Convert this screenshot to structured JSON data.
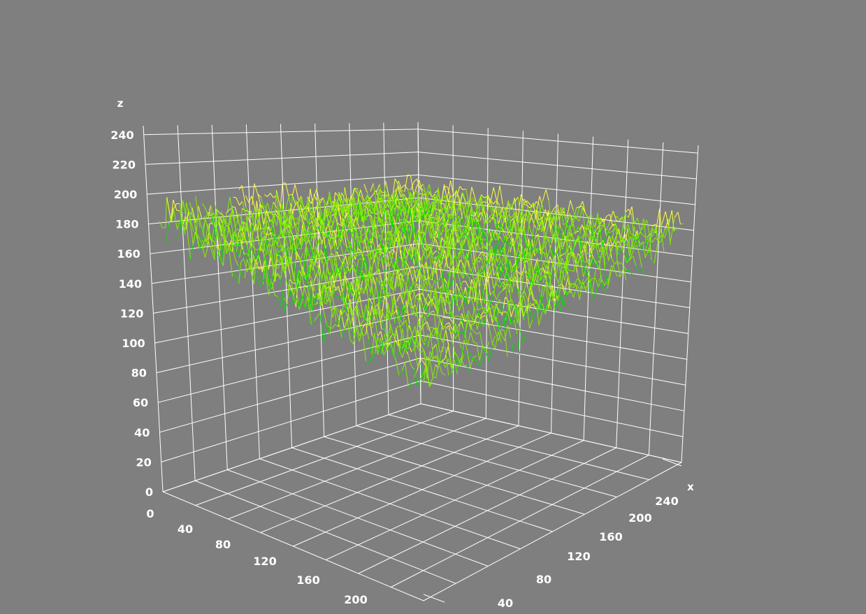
{
  "chart_data": {
    "type": "surface-3d",
    "title": "",
    "xlabel": "x",
    "ylabel": "",
    "zlabel": "z",
    "x_ticks": [
      40,
      80,
      120,
      160,
      200,
      240
    ],
    "y_ticks": [
      0,
      40,
      80,
      120,
      160,
      200
    ],
    "z_ticks": [
      0,
      20,
      40,
      60,
      80,
      100,
      120,
      140,
      160,
      180,
      200,
      220,
      240
    ],
    "xlim": [
      0,
      256
    ],
    "ylim": [
      0,
      256
    ],
    "zlim": [
      0,
      240
    ],
    "grid": true,
    "background_color": "#7f7f7f",
    "grid_color": "#ffffff",
    "surface": {
      "description_values": "noisy height field",
      "z_mean": 185,
      "z_min": 158,
      "z_max": 212,
      "colormap": [
        "#00e000",
        "#80f000",
        "#ffff40",
        "#ffffff"
      ]
    }
  }
}
